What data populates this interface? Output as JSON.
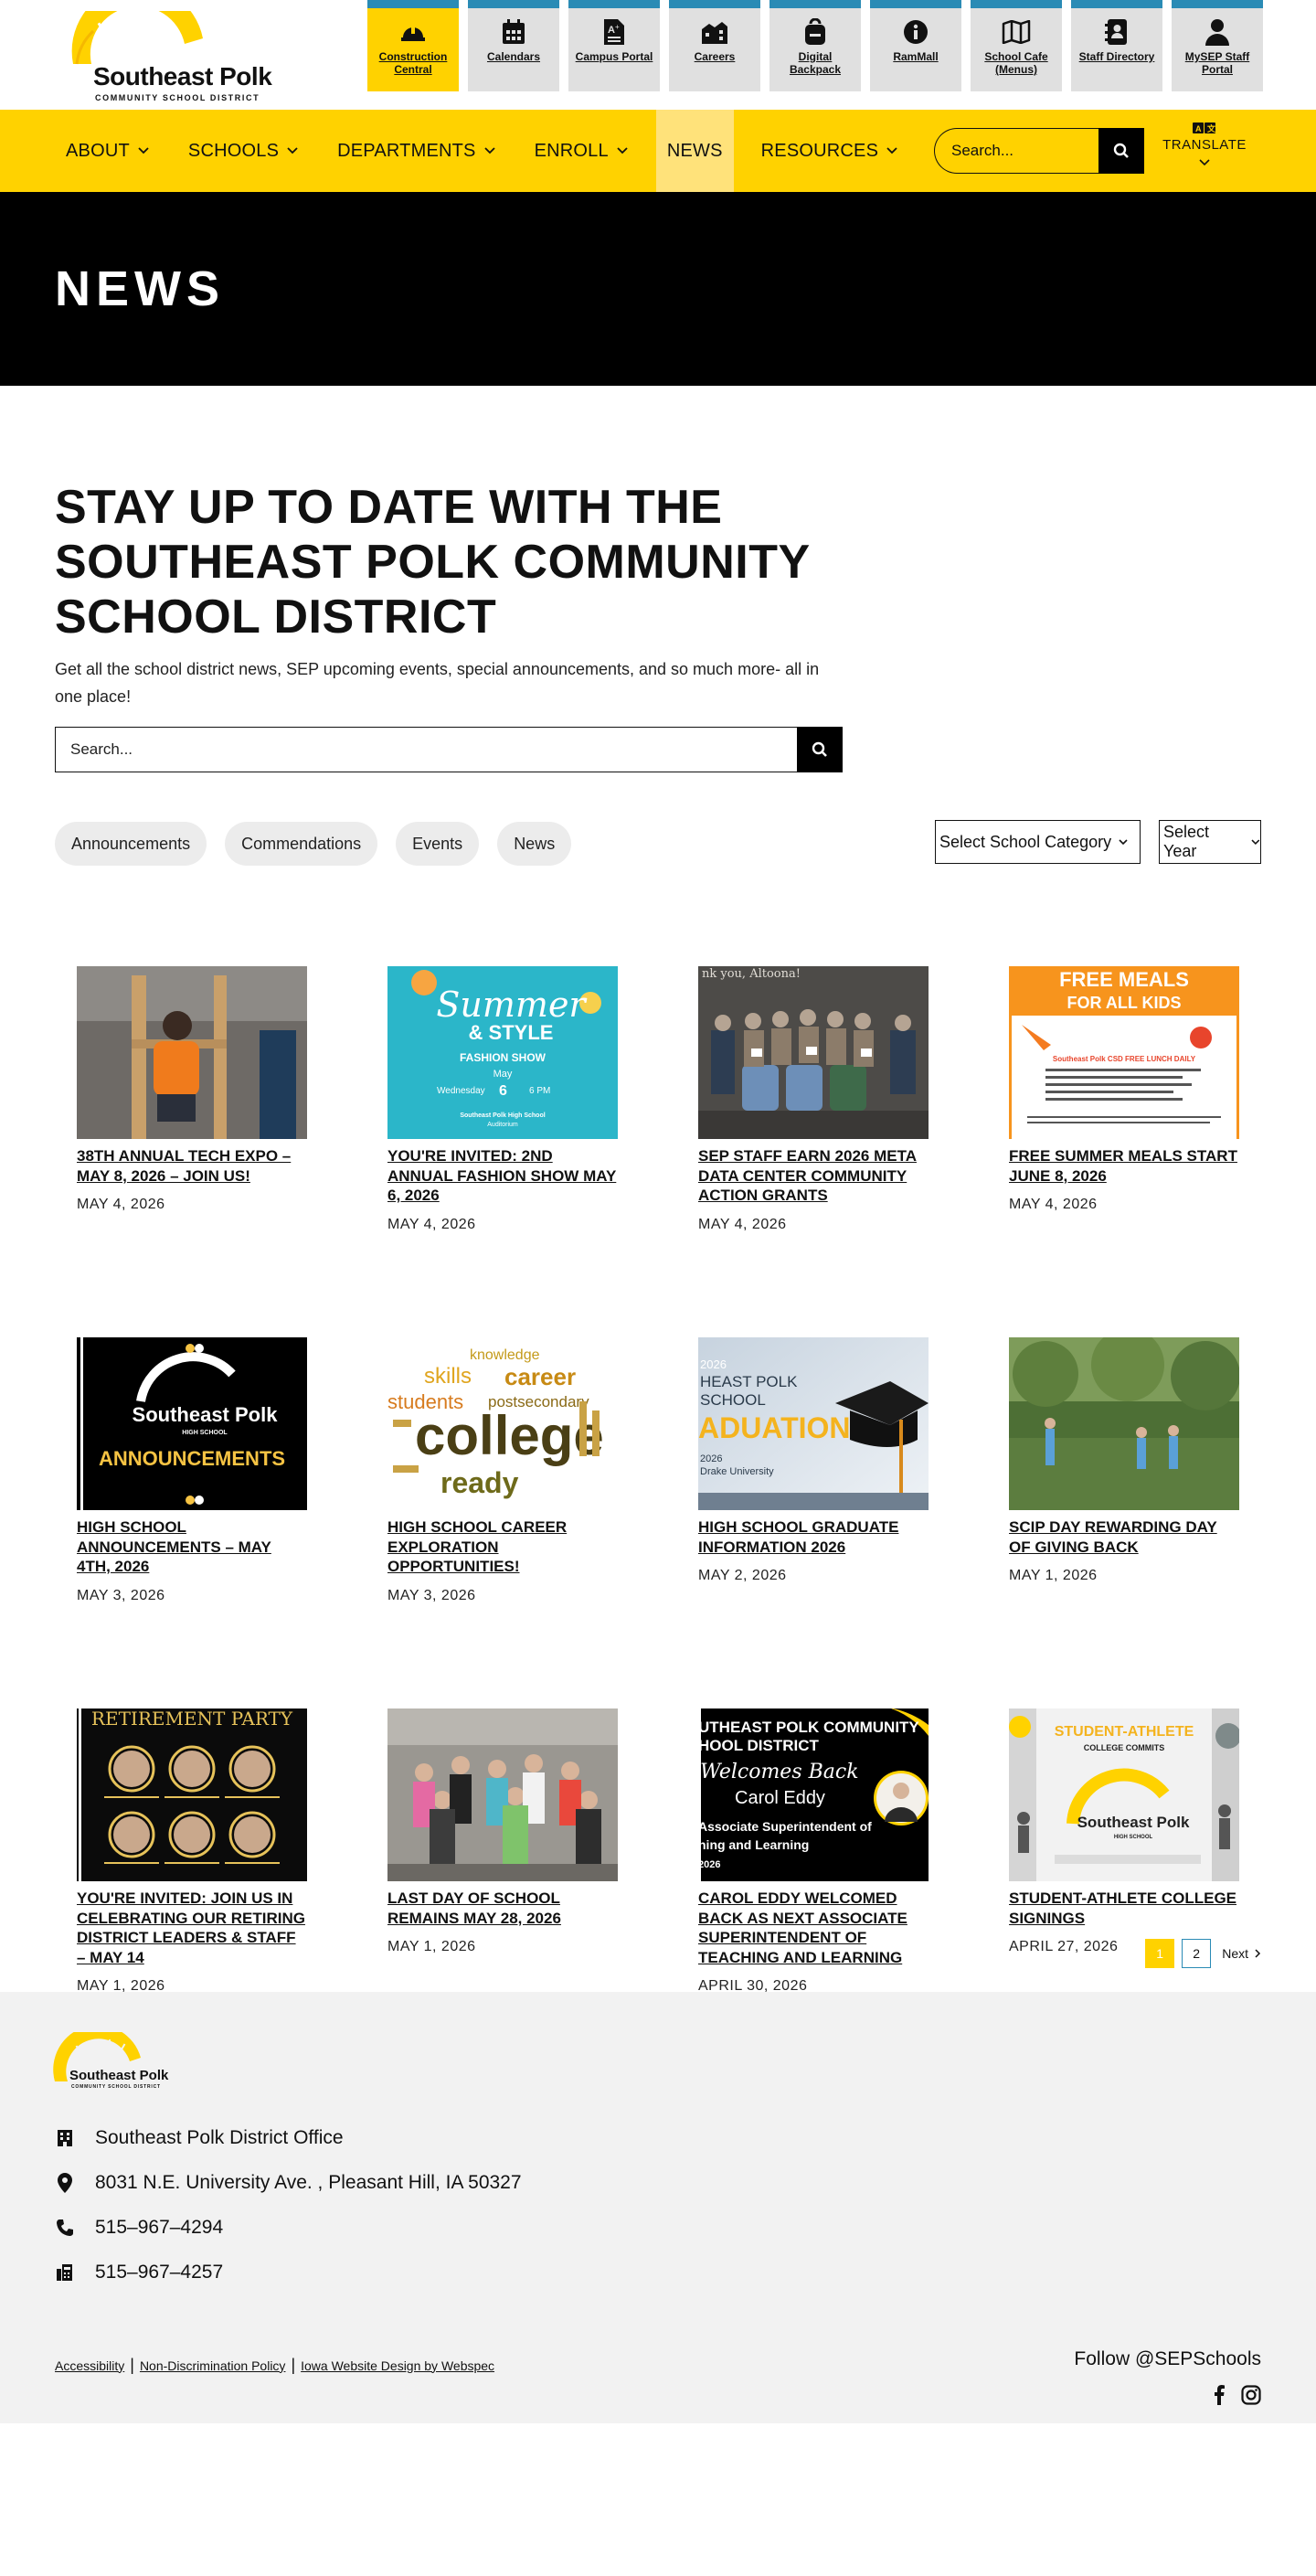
{
  "brand": {
    "name": "Southeast Polk",
    "sub": "COMMUNITY SCHOOL DISTRICT",
    "yellow": "#ffd200",
    "blue": "#2a8bb5",
    "black": "#000000"
  },
  "quicklinks": [
    {
      "label": "Construction Central",
      "icon": "hardhat-icon",
      "active": true
    },
    {
      "label": "Calendars",
      "icon": "calendar-icon"
    },
    {
      "label": "Campus Portal",
      "icon": "grade-document-icon"
    },
    {
      "label": "Careers",
      "icon": "building-icon"
    },
    {
      "label": "Digital Backpack",
      "icon": "backpack-icon"
    },
    {
      "label": "RamMall",
      "icon": "info-icon"
    },
    {
      "label": "School Cafe (Menus)",
      "icon": "map-icon"
    },
    {
      "label": "Staff Directory",
      "icon": "contact-book-icon"
    },
    {
      "label": "MySEP Staff Portal",
      "icon": "person-icon"
    }
  ],
  "nav": {
    "items": [
      {
        "label": "ABOUT",
        "dropdown": true
      },
      {
        "label": "SCHOOLS",
        "dropdown": true
      },
      {
        "label": "DEPARTMENTS",
        "dropdown": true
      },
      {
        "label": "ENROLL",
        "dropdown": true
      },
      {
        "label": "NEWS",
        "dropdown": false,
        "active": true
      },
      {
        "label": "RESOURCES",
        "dropdown": true
      }
    ],
    "search_placeholder": "Search...",
    "translate": "TRANSLATE"
  },
  "hero": {
    "title": "NEWS"
  },
  "intro": {
    "heading": "STAY UP TO DATE WITH THE SOUTHEAST POLK COMMUNITY SCHOOL DISTRICT",
    "text": "Get all the school district news, SEP upcoming events, special announcements, and so much more- all in one place!",
    "search_placeholder": "Search..."
  },
  "filters": {
    "pills": [
      "Announcements",
      "Commendations",
      "Events",
      "News"
    ],
    "category_select": "Select School Category",
    "year_select": "Select Year"
  },
  "articles": [
    {
      "title": "38TH ANNUAL TECH EXPO – MAY 8, 2026 – JOIN US!",
      "date": "MAY 4, 2026",
      "thumb": "tech-expo-photo"
    },
    {
      "title": "YOU'RE INVITED: 2ND ANNUAL FASHION SHOW MAY 6, 2026",
      "date": "MAY 4, 2026",
      "thumb": "summer-style-flyer",
      "thumb_text": [
        "Summer",
        "& STYLE",
        "FASHION SHOW",
        "May",
        "Wednesday",
        "6",
        "6 PM",
        "Southeast Polk High School",
        "Auditorium"
      ]
    },
    {
      "title": "SEP STAFF EARN 2026 META DATA CENTER COMMUNITY ACTION GRANTS",
      "date": "MAY 4, 2026",
      "thumb": "staff-group-photo",
      "thumb_text": [
        "nk you, Altoona!"
      ]
    },
    {
      "title": "FREE SUMMER MEALS START JUNE 8, 2026",
      "date": "MAY 4, 2026",
      "thumb": "free-meals-flyer",
      "thumb_text": [
        "FREE MEALS",
        "FOR ALL KIDS",
        "Southeast Polk CSD FREE LUNCH DAILY"
      ]
    },
    {
      "title": "HIGH SCHOOL ANNOUNCEMENTS – MAY 4TH, 2026",
      "date": "MAY 3, 2026",
      "thumb": "announcements-graphic",
      "thumb_text": [
        "Southeast Polk",
        "HIGH SCHOOL",
        "ANNOUNCEMENTS"
      ]
    },
    {
      "title": "HIGH SCHOOL CAREER EXPLORATION OPPORTUNITIES!",
      "date": "MAY 3, 2026",
      "thumb": "career-word-cloud",
      "thumb_text": [
        "knowledge",
        "skills",
        "career",
        "students",
        "postsecondary",
        "college",
        "ready"
      ]
    },
    {
      "title": "HIGH SCHOOL GRADUATE INFORMATION 2026",
      "date": "MAY 2, 2026",
      "thumb": "graduation-graphic",
      "thumb_text": [
        "2026",
        "HEAST POLK",
        "SCHOOL",
        "ADUATION",
        "2026",
        "Drake University"
      ]
    },
    {
      "title": "SCIP DAY REWARDING DAY OF GIVING BACK",
      "date": "MAY 1, 2026",
      "thumb": "outdoor-volunteers-photo"
    },
    {
      "title": "YOU'RE INVITED: JOIN US IN CELEBRATING OUR RETIRING DISTRICT LEADERS & STAFF – MAY 14",
      "date": "MAY 1, 2026",
      "thumb": "retirement-party-flyer",
      "thumb_text": [
        "RETIREMENT PARTY"
      ]
    },
    {
      "title": "LAST DAY OF SCHOOL REMAINS MAY 28, 2026",
      "date": "MAY 1, 2026",
      "thumb": "students-celebrating-photo"
    },
    {
      "title": "CAROL EDDY WELCOMED BACK AS NEXT ASSOCIATE SUPERINTENDENT OF TEACHING AND LEARNING",
      "date": "APRIL 30, 2026",
      "thumb": "carol-eddy-graphic",
      "thumb_text": [
        "UTHEAST POLK COMMUNITY",
        "HOOL DISTRICT",
        "Welcomes Back",
        "Carol Eddy",
        "Associate Superintendent of",
        "hing and Learning",
        "2026"
      ]
    },
    {
      "title": "STUDENT-ATHLETE COLLEGE SIGNINGS",
      "date": "APRIL 27, 2026",
      "thumb": "student-athlete-graphic",
      "thumb_text": [
        "STUDENT-ATHLETE",
        "COLLEGE COMMITS",
        "Southeast Polk",
        "HIGH SCHOOL"
      ]
    }
  ],
  "pagination": {
    "pages": [
      "1",
      "2"
    ],
    "current": "1",
    "next": "Next"
  },
  "footer": {
    "office": "Southeast Polk District Office",
    "address": "8031 N.E. University Ave. , Pleasant Hill, IA  50327",
    "phone": "515–967–4294",
    "fax": "515–967–4257",
    "links": [
      "Accessibility",
      "Non-Discrimination Policy",
      "Iowa Website Design by Webspec"
    ],
    "follow": "Follow @SEPSchools"
  }
}
